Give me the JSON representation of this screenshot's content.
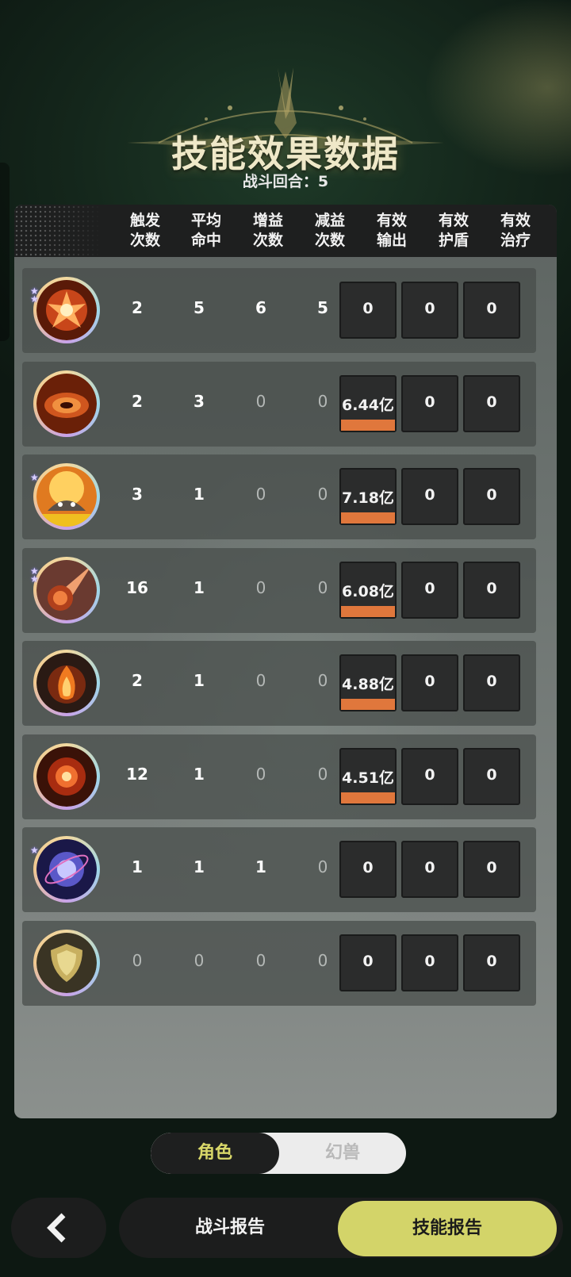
{
  "header": {
    "title": "技能效果数据",
    "round_label": "战斗回合：5"
  },
  "columns": [
    [
      "触发",
      "次数"
    ],
    [
      "平均",
      "命中"
    ],
    [
      "增益",
      "次数"
    ],
    [
      "减益",
      "次数"
    ],
    [
      "有效",
      "输出"
    ],
    [
      "有效",
      "护盾"
    ],
    [
      "有效",
      "治疗"
    ]
  ],
  "rows": [
    {
      "icon": "fire-burst-skill-icon",
      "stars": "★★",
      "trigger": "2",
      "avg_hit": "5",
      "buff": "6",
      "debuff": "5",
      "damage": "0",
      "damage_fraction": 0,
      "shield": "0",
      "heal": "0"
    },
    {
      "icon": "fire-vortex-skill-icon",
      "stars": "",
      "trigger": "2",
      "avg_hit": "3",
      "buff": "0",
      "debuff": "0",
      "damage": "6.44亿",
      "damage_fraction": 1,
      "shield": "0",
      "heal": "0"
    },
    {
      "icon": "fire-beast-skill-icon",
      "stars": "★",
      "trigger": "3",
      "avg_hit": "1",
      "buff": "0",
      "debuff": "0",
      "damage": "7.18亿",
      "damage_fraction": 1,
      "shield": "0",
      "heal": "0"
    },
    {
      "icon": "meteor-skill-icon",
      "stars": "★★",
      "trigger": "16",
      "avg_hit": "1",
      "buff": "0",
      "debuff": "0",
      "damage": "6.08亿",
      "damage_fraction": 1,
      "shield": "0",
      "heal": "0"
    },
    {
      "icon": "fire-hand-skill-icon",
      "stars": "",
      "trigger": "2",
      "avg_hit": "1",
      "buff": "0",
      "debuff": "0",
      "damage": "4.88亿",
      "damage_fraction": 1,
      "shield": "0",
      "heal": "0"
    },
    {
      "icon": "fire-orb-skill-icon",
      "stars": "",
      "trigger": "12",
      "avg_hit": "1",
      "buff": "0",
      "debuff": "0",
      "damage": "4.51亿",
      "damage_fraction": 1,
      "shield": "0",
      "heal": "0"
    },
    {
      "icon": "arcane-orb-skill-icon",
      "stars": "★",
      "trigger": "1",
      "avg_hit": "1",
      "buff": "1",
      "debuff": "0",
      "damage": "0",
      "damage_fraction": 0,
      "shield": "0",
      "heal": "0"
    },
    {
      "icon": "shield-skill-icon",
      "stars": "",
      "trigger": "0",
      "avg_hit": "0",
      "buff": "0",
      "debuff": "0",
      "damage": "0",
      "damage_fraction": 0,
      "shield": "0",
      "heal": "0"
    }
  ],
  "toggle": {
    "active": "角色",
    "inactive": "幻兽"
  },
  "nav": {
    "battle_report": "战斗报告",
    "skill_report": "技能报告"
  },
  "colors": {
    "accent_yellow": "#d3d469",
    "damage_bar": "#e0773c",
    "title_gold": "#efe8c8"
  }
}
